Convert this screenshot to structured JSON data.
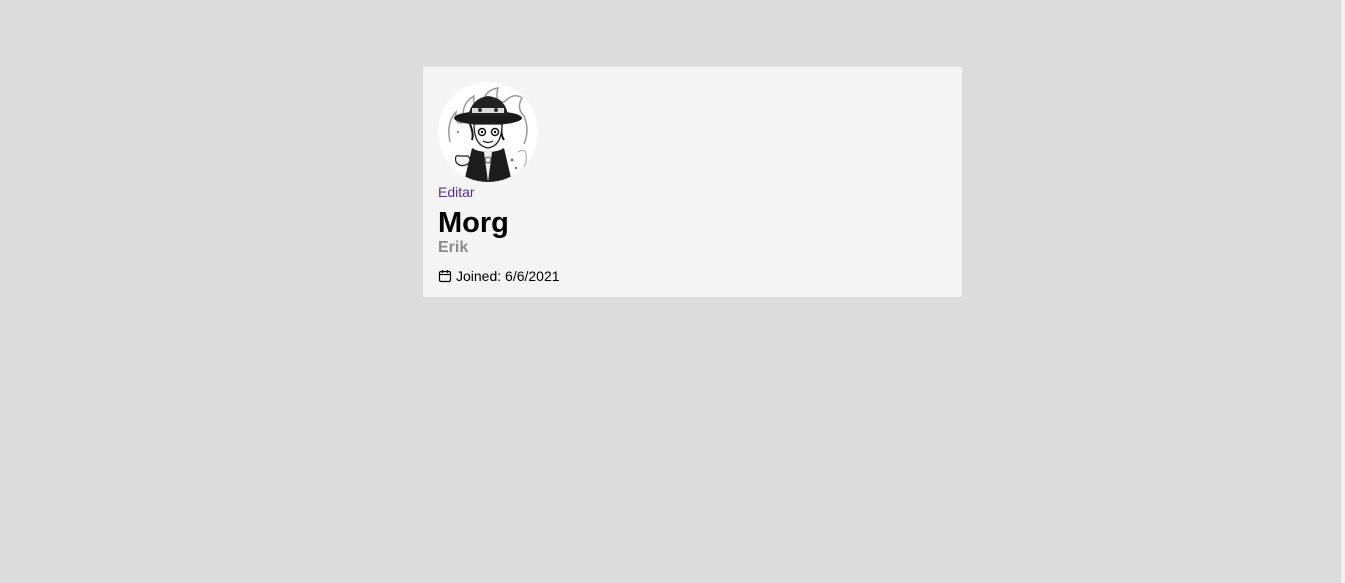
{
  "profile": {
    "edit_label": "Editar",
    "display_name": "Morg",
    "username": "Erik",
    "joined_label": "Joined:",
    "joined_date": "6/6/2021",
    "avatar_icon": "avatar-illustration",
    "calendar_icon": "calendar-icon"
  },
  "colors": {
    "page_background": "#dcdcdc",
    "card_background": "#f4f4f4",
    "edit_link": "#5b2d90",
    "username_text": "#8b8b8b"
  }
}
